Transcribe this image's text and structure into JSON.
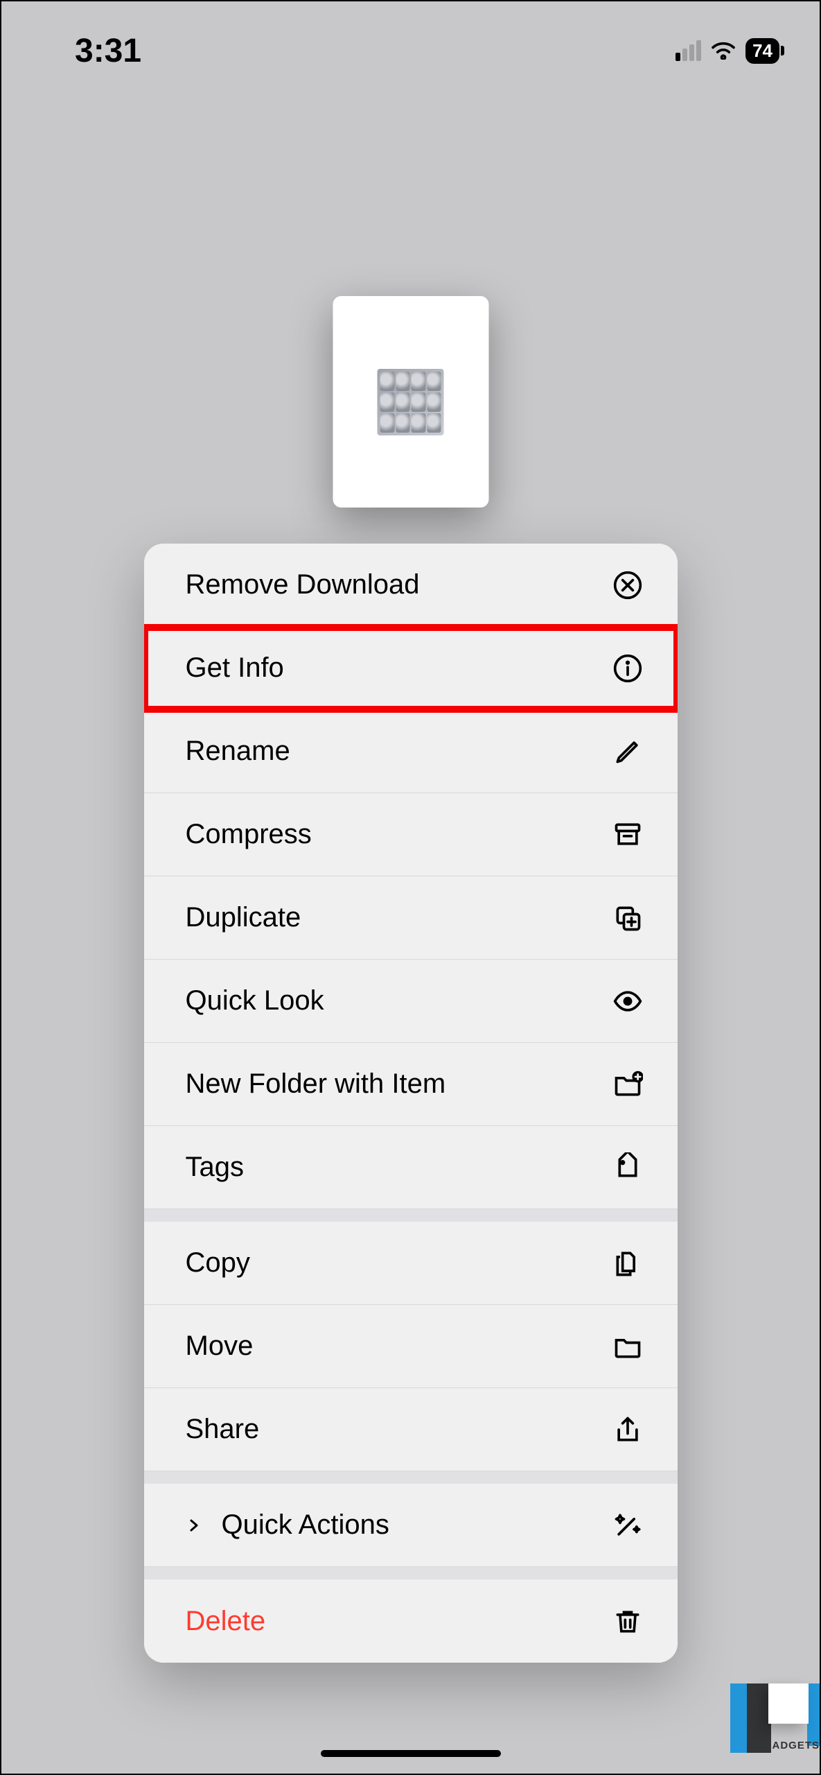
{
  "status": {
    "time": "3:31",
    "battery": "74"
  },
  "menu": {
    "remove_download": "Remove Download",
    "get_info": "Get Info",
    "rename": "Rename",
    "compress": "Compress",
    "duplicate": "Duplicate",
    "quick_look": "Quick Look",
    "new_folder": "New Folder with Item",
    "tags": "Tags",
    "copy": "Copy",
    "move": "Move",
    "share": "Share",
    "quick_actions": "Quick Actions",
    "delete": "Delete"
  },
  "watermark": "GADGETS"
}
